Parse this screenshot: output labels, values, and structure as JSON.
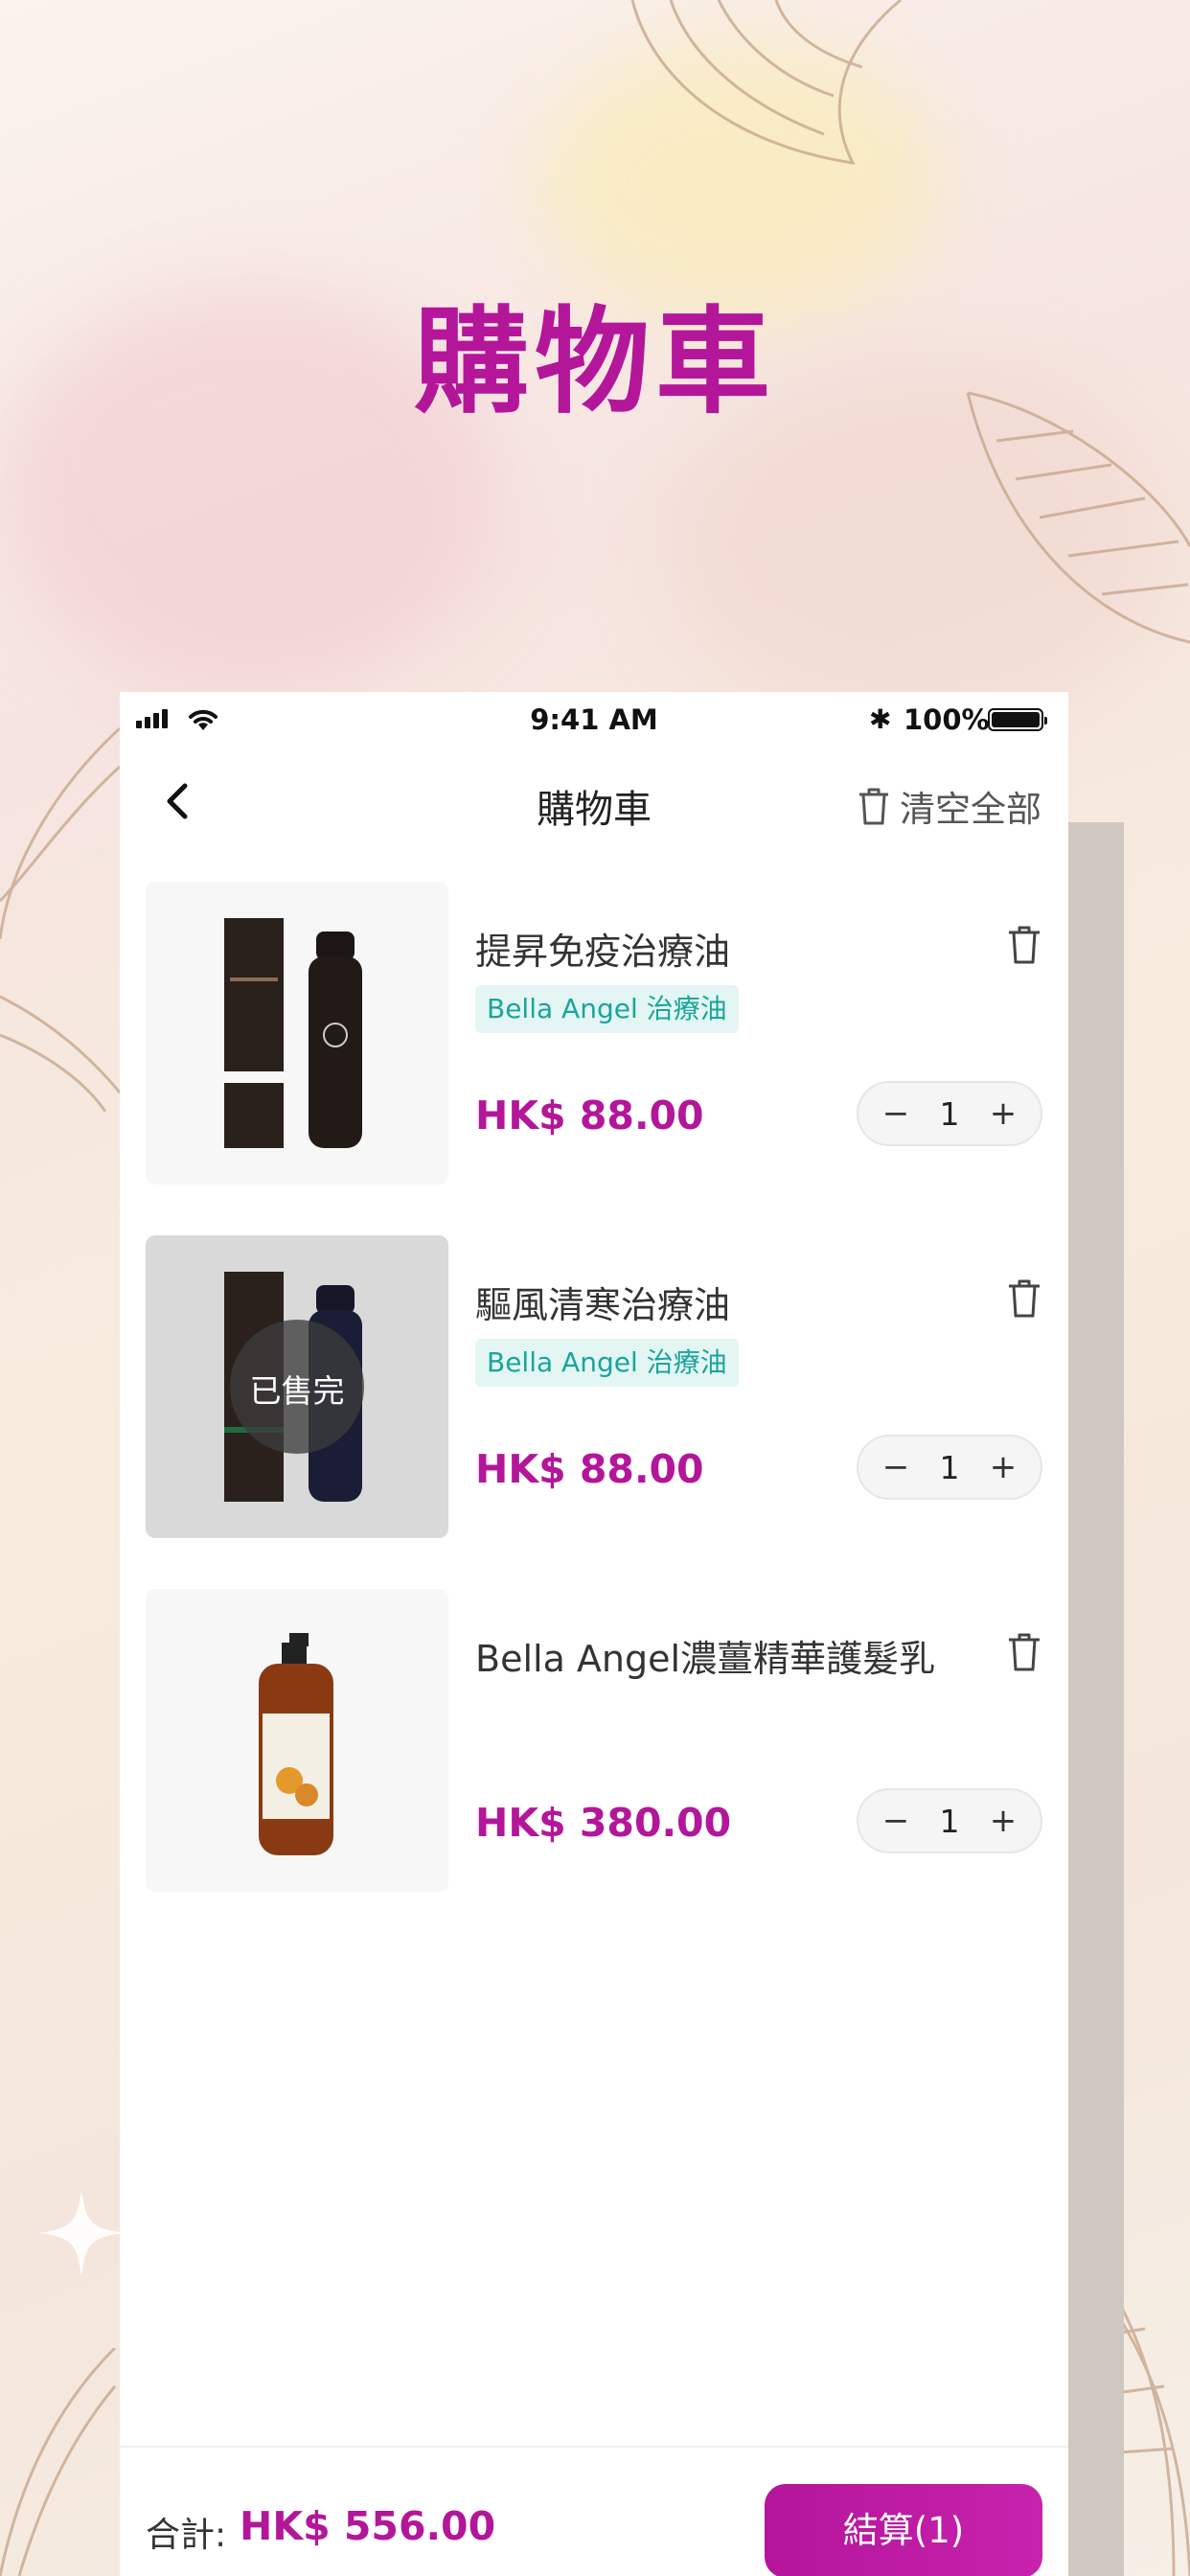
{
  "hero": {
    "title": "購物車"
  },
  "status_bar": {
    "time": "9:41 AM",
    "battery": "100%"
  },
  "nav": {
    "title": "購物車",
    "clear_all": "清空全部"
  },
  "items": [
    {
      "name": "提昇免疫治療油",
      "tag": "Bella Angel 治療油",
      "price": "HK$ 88.00",
      "qty": "1",
      "sold_out": false
    },
    {
      "name": "驅風清寒治療油",
      "tag": "Bella Angel 治療油",
      "price": "HK$ 88.00",
      "qty": "1",
      "sold_out": true,
      "sold_out_label": "已售完"
    },
    {
      "name": "Bella Angel濃薑精華護髮乳",
      "tag": "",
      "price": "HK$ 380.00",
      "qty": "1",
      "sold_out": false
    }
  ],
  "stepper": {
    "minus": "−",
    "plus": "+"
  },
  "footer": {
    "total_label": "合計:",
    "total_value": "HK$ 556.00",
    "checkout": "結算(1)"
  },
  "colors": {
    "accent": "#b4169a",
    "tag_text": "#1aa59a",
    "tag_bg": "#e3f6f4"
  }
}
